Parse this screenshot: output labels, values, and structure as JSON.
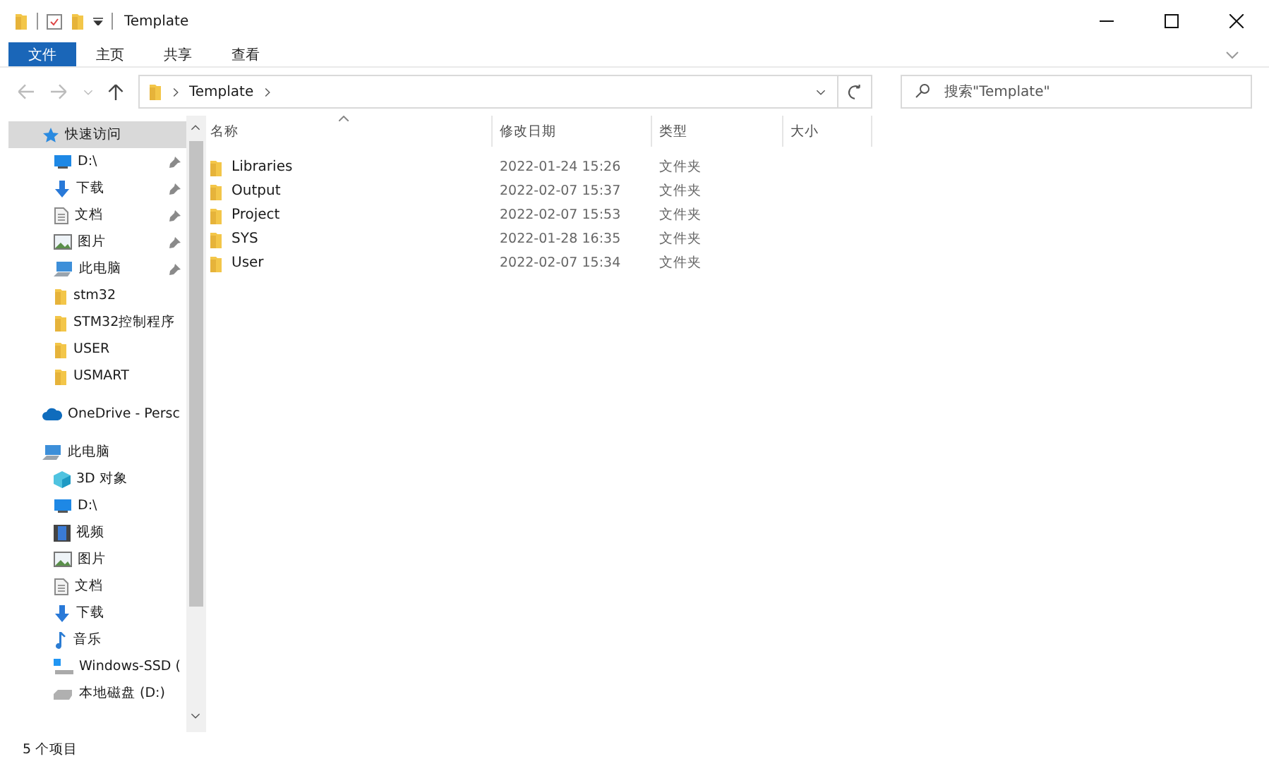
{
  "window": {
    "title": "Template"
  },
  "ribbon_tabs": [
    {
      "label": "文件",
      "selected": true
    },
    {
      "label": "主页",
      "selected": false
    },
    {
      "label": "共享",
      "selected": false
    },
    {
      "label": "查看",
      "selected": false
    }
  ],
  "address": {
    "path": [
      "Template"
    ]
  },
  "search": {
    "placeholder": "搜索\"Template\""
  },
  "sidebar": {
    "items": [
      {
        "label": "快速访问",
        "kind": "star",
        "selected": true,
        "children": [
          {
            "label": "D:\\",
            "kind": "drive",
            "pinned": true
          },
          {
            "label": "下载",
            "kind": "download",
            "pinned": true
          },
          {
            "label": "文档",
            "kind": "document",
            "pinned": true
          },
          {
            "label": "图片",
            "kind": "image",
            "pinned": true
          },
          {
            "label": "此电脑",
            "kind": "pc",
            "pinned": true
          },
          {
            "label": "stm32",
            "kind": "folder",
            "pinned": false
          },
          {
            "label": "STM32控制程序",
            "kind": "folder",
            "pinned": false
          },
          {
            "label": "USER",
            "kind": "folder",
            "pinned": false
          },
          {
            "label": "USMART",
            "kind": "folder",
            "pinned": false
          }
        ]
      },
      {
        "label": "OneDrive - Persc",
        "kind": "cloud",
        "selected": false
      },
      {
        "label": "此电脑",
        "kind": "pc",
        "selected": false,
        "children": [
          {
            "label": "3D 对象",
            "kind": "cube",
            "pinned": false
          },
          {
            "label": "D:\\",
            "kind": "drive",
            "pinned": false
          },
          {
            "label": "视频",
            "kind": "video",
            "pinned": false
          },
          {
            "label": "图片",
            "kind": "image",
            "pinned": false
          },
          {
            "label": "文档",
            "kind": "document",
            "pinned": false
          },
          {
            "label": "下载",
            "kind": "download",
            "pinned": false
          },
          {
            "label": "音乐",
            "kind": "music",
            "pinned": false
          },
          {
            "label": "Windows-SSD (",
            "kind": "windisk",
            "pinned": false
          },
          {
            "label": "本地磁盘 (D:)",
            "kind": "disk",
            "pinned": false
          }
        ]
      }
    ]
  },
  "table": {
    "columns": [
      "名称",
      "修改日期",
      "类型",
      "大小"
    ],
    "rows": [
      {
        "name": "Libraries",
        "modified": "2022-01-24 15:26",
        "type": "文件夹"
      },
      {
        "name": "Output",
        "modified": "2022-02-07 15:37",
        "type": "文件夹"
      },
      {
        "name": "Project",
        "modified": "2022-02-07 15:53",
        "type": "文件夹"
      },
      {
        "name": "SYS",
        "modified": "2022-01-28 16:35",
        "type": "文件夹"
      },
      {
        "name": "User",
        "modified": "2022-02-07 15:34",
        "type": "文件夹"
      }
    ]
  },
  "status_bar": {
    "count": "5 个项目"
  }
}
